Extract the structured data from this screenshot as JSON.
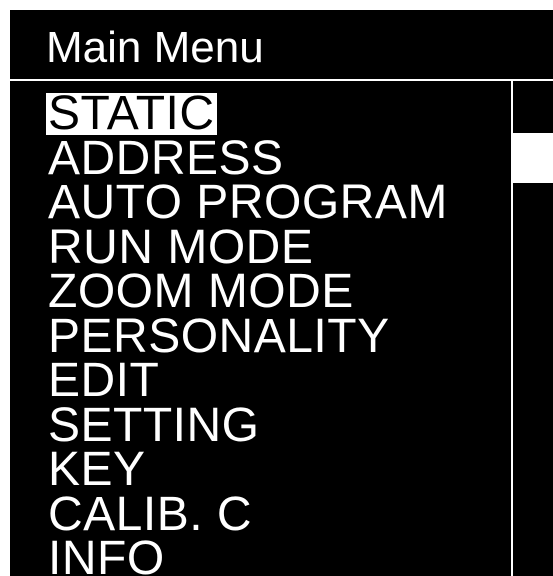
{
  "header": {
    "title": "Main Menu"
  },
  "menu": {
    "selected_index": 0,
    "items": [
      {
        "label": "STATIC"
      },
      {
        "label": "ADDRESS"
      },
      {
        "label": "AUTO PROGRAM"
      },
      {
        "label": "RUN MODE"
      },
      {
        "label": "ZOOM MODE"
      },
      {
        "label": "PERSONALITY"
      },
      {
        "label": "EDIT"
      },
      {
        "label": "SETTING"
      },
      {
        "label": "KEY"
      },
      {
        "label": "CALIB. C"
      },
      {
        "label": "INFO"
      }
    ]
  },
  "colors": {
    "background": "#000000",
    "foreground": "#ffffff",
    "highlight_bg": "#ffffff",
    "highlight_fg": "#000000"
  }
}
